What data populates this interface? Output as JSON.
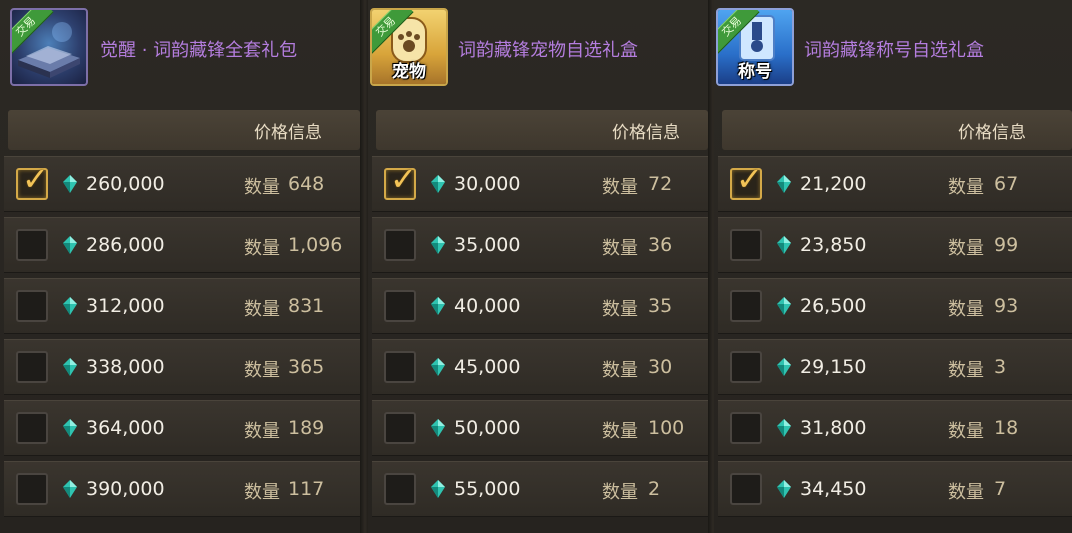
{
  "colors": {
    "title": "#b47dde",
    "price": "#f1ede4",
    "qty": "#cdbf9f",
    "check_gold": "#d4a948",
    "gem": "#2fc3b0"
  },
  "panels": [
    {
      "badge": "交易",
      "icon": "book-icon",
      "icon_caption": "",
      "title": "觉醒 · 词韵藏锋全套礼包",
      "price_header": "价格信息",
      "qty_label": "数量",
      "rows": [
        {
          "price": "260,000",
          "qty": "648",
          "checked": true
        },
        {
          "price": "286,000",
          "qty": "1,096",
          "checked": false
        },
        {
          "price": "312,000",
          "qty": "831",
          "checked": false
        },
        {
          "price": "338,000",
          "qty": "365",
          "checked": false
        },
        {
          "price": "364,000",
          "qty": "189",
          "checked": false
        },
        {
          "price": "390,000",
          "qty": "117",
          "checked": false
        }
      ]
    },
    {
      "badge": "交易",
      "icon": "pet-paw-icon",
      "icon_caption": "宠物",
      "title": "词韵藏锋宠物自选礼盒",
      "price_header": "价格信息",
      "qty_label": "数量",
      "rows": [
        {
          "price": "30,000",
          "qty": "72",
          "checked": true
        },
        {
          "price": "35,000",
          "qty": "36",
          "checked": false
        },
        {
          "price": "40,000",
          "qty": "35",
          "checked": false
        },
        {
          "price": "45,000",
          "qty": "30",
          "checked": false
        },
        {
          "price": "50,000",
          "qty": "100",
          "checked": false
        },
        {
          "price": "55,000",
          "qty": "2",
          "checked": false
        }
      ]
    },
    {
      "badge": "交易",
      "icon": "title-medal-icon",
      "icon_caption": "称号",
      "title": "词韵藏锋称号自选礼盒",
      "price_header": "价格信息",
      "qty_label": "数量",
      "rows": [
        {
          "price": "21,200",
          "qty": "67",
          "checked": true
        },
        {
          "price": "23,850",
          "qty": "99",
          "checked": false
        },
        {
          "price": "26,500",
          "qty": "93",
          "checked": false
        },
        {
          "price": "29,150",
          "qty": "3",
          "checked": false
        },
        {
          "price": "31,800",
          "qty": "18",
          "checked": false
        },
        {
          "price": "34,450",
          "qty": "7",
          "checked": false
        }
      ]
    }
  ]
}
